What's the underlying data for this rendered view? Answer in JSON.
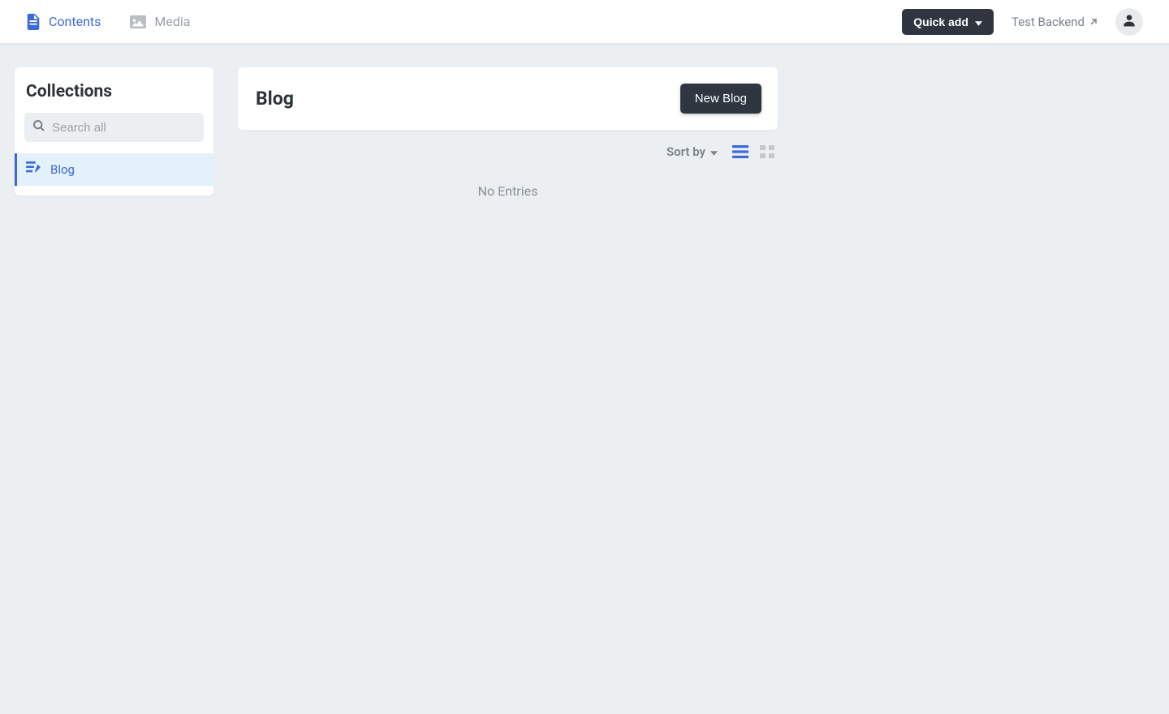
{
  "header": {
    "nav": {
      "contents": "Contents",
      "media": "Media"
    },
    "quick_add": "Quick add",
    "test_backend": "Test Backend"
  },
  "sidebar": {
    "title": "Collections",
    "search_placeholder": "Search all",
    "items": [
      {
        "label": "Blog",
        "active": true
      }
    ]
  },
  "main": {
    "title": "Blog",
    "new_button": "New Blog",
    "sort_label": "Sort by",
    "empty": "No Entries"
  },
  "colors": {
    "accent": "#3b68da",
    "dark": "#2f3640",
    "muted": "#9aa0a6",
    "bg": "#eceff1"
  }
}
